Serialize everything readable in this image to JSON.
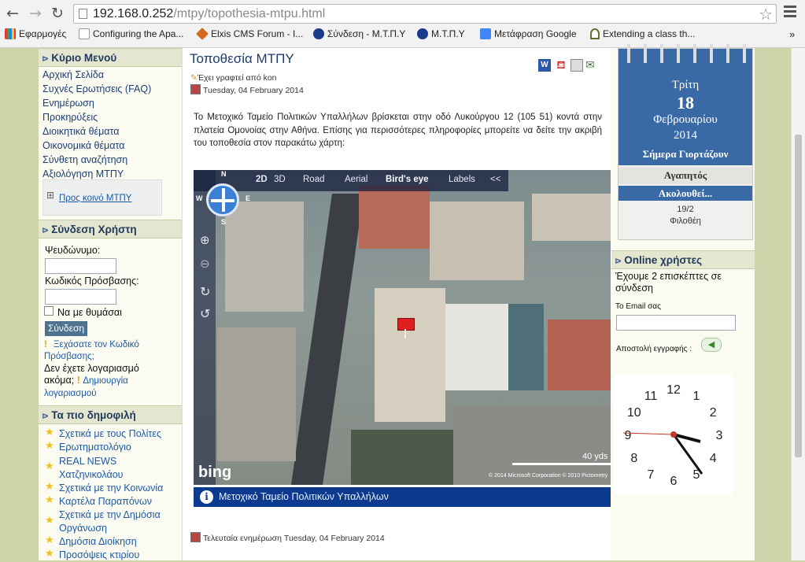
{
  "browser": {
    "url_host": "192.168.0.252",
    "url_path": "/mtpy/topothesia-mtpu.html",
    "bookmarks": [
      {
        "label": "Εφαρμογές",
        "color": "#4285f4"
      },
      {
        "label": "Configuring the Apa...",
        "color": "#c0392b"
      },
      {
        "label": "Elxis CMS Forum - I...",
        "color": "#d2691e"
      },
      {
        "label": "Σύνδεση - Μ.Τ.Π.Υ",
        "color": "#1a3a8a"
      },
      {
        "label": "Μ.Τ.Π.Υ",
        "color": "#1a3a8a"
      },
      {
        "label": "Μετάφραση Google",
        "color": "#4285f4"
      },
      {
        "label": "Extending a class th...",
        "color": "#6b6b2a"
      }
    ],
    "bookmarks_more": "»"
  },
  "left": {
    "main_menu": {
      "title": "Κύριο Μενού",
      "items": [
        "Αρχική Σελίδα",
        "Συχνές Ερωτήσεις (FAQ)",
        "Ενημέρωση",
        "Προκηρύξεις",
        "Διοικητικά θέματα",
        "Οικονομικά θέματα",
        "Σύνθετη αναζήτηση",
        "Αξιολόγηση ΜΤΠΥ"
      ],
      "sub_link": "Προς κοινό ΜΤΠΥ"
    },
    "login": {
      "title": "Σύνδεση Χρήστη",
      "username_label": "Ψευδώνυμο:",
      "password_label": "Κωδικός Πρόσβασης:",
      "remember_label": "Να με θυμάσαι",
      "submit_label": "Σύνδεση",
      "forgot_link": "Ξεχάσατε τον Κωδικό Πρόσβασης;",
      "no_account_text": "Δεν έχετε λογαριασμό ακόμα;",
      "create_link": "Δημιουργία λογαριασμού"
    },
    "popular": {
      "title": "Τα πιο δημοφιλή",
      "items": [
        "Σχετικά με τους Πολίτες",
        "Ερωτηματολόγιο",
        "REAL NEWS Χατζηνικολάου",
        "Σχετικά με την Κοινωνία",
        "Καρτέλα Παραπόνων",
        "Σχετικά με την Δημόσια Οργάνωση",
        "Δημόσια Διοίκηση",
        "Προσόψεις κτιρίου"
      ]
    }
  },
  "article": {
    "title": "Τοποθεσία ΜΤΠΥ",
    "author": "Έχει γραφτεί από kon",
    "date": "Tuesday, 04 February 2014",
    "body": "Το Μετοχικό Ταμείο Πολιτικών Υπαλλήλων βρίσκεται στην οδό Λυκούργου 12 (105 51) κοντά στην πλατεία Ομονοίας στην Αθήνα. Επίσης για περισσότερες πληροφορίες μπορείτε να δείτε την ακριβή του τοποθεσία στον παρακάτω χάρτη:",
    "last_updated": "Τελευταία ενημέρωση Tuesday, 04 February 2014",
    "map": {
      "toolbar": {
        "mode_2d": "2D",
        "mode_3d": "3D",
        "road": "Road",
        "aerial": "Aerial",
        "birds_eye": "Bird's eye",
        "labels": "Labels",
        "collapse": "<<"
      },
      "compass": {
        "n": "N",
        "s": "S",
        "w": "W",
        "e": "E"
      },
      "scale": "40 yds",
      "logo": "bing",
      "copyright": "© 2014 Microsoft Corporation   © 2010 Pictometry",
      "caption": "Μετοχικό Ταμείο Πολιτικών Υπαλλήλων"
    }
  },
  "right": {
    "calendar": {
      "day": "Τρίτη",
      "date": "18",
      "month": "Φεβρουαρίου",
      "year": "2014",
      "nameday_header": "Σήμερα Γιορτάζουν",
      "name1": "Αγαπητός",
      "more": "Ακολουθεί...",
      "next_date": "19/2",
      "next_name": "Φιλοθέη"
    },
    "online": {
      "title": "Online χρήστες",
      "text": "Έχουμε 2 επισκέπτες σε σύνδεση",
      "email_label": "Το Email σας",
      "subscribe_label": "Αποστολή εγγραφής :"
    },
    "clock": {
      "numerals": [
        "12",
        "1",
        "2",
        "3",
        "4",
        "5",
        "6",
        "7",
        "8",
        "9",
        "10",
        "11"
      ]
    }
  }
}
